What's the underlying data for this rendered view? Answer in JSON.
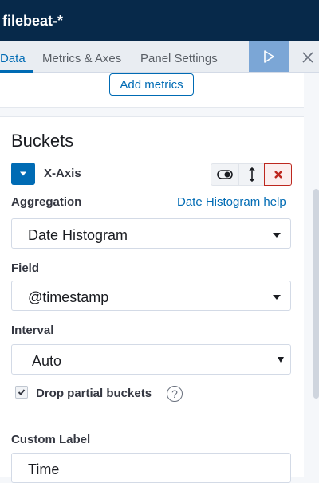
{
  "header": {
    "title": "filebeat-*"
  },
  "tabs": [
    {
      "label": "Data",
      "active": true
    },
    {
      "label": "Metrics & Axes",
      "active": false
    },
    {
      "label": "Panel Settings",
      "active": false
    }
  ],
  "toolbar": {
    "apply_icon": "play-icon",
    "close_icon": "close-icon"
  },
  "metrics": {
    "add_label": "Add metrics"
  },
  "buckets": {
    "heading": "Buckets",
    "agg_title": "X-Axis",
    "aggregation": {
      "label": "Aggregation",
      "help_link": "Date Histogram help",
      "value": "Date Histogram"
    },
    "field": {
      "label": "Field",
      "value": "@timestamp"
    },
    "interval": {
      "label": "Interval",
      "value": "Auto"
    },
    "drop_partial": {
      "label": "Drop partial buckets",
      "checked": true,
      "help_icon_text": "?"
    },
    "custom_label": {
      "label": "Custom Label",
      "value": "Time"
    }
  },
  "colors": {
    "accent": "#006bb4",
    "header_bg": "#07294a",
    "danger": "#bd271e"
  }
}
